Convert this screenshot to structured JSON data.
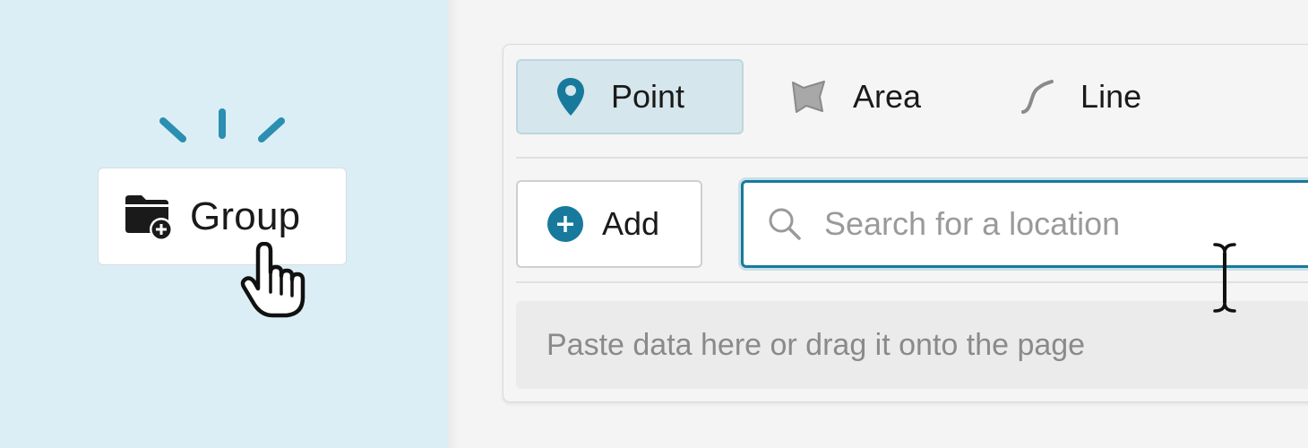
{
  "group_button": {
    "label": "Group",
    "icon": "folder-add-icon"
  },
  "tabs": [
    {
      "label": "Point",
      "icon": "map-pin-icon",
      "active": true
    },
    {
      "label": "Area",
      "icon": "area-icon",
      "active": false
    },
    {
      "label": "Line",
      "icon": "line-icon",
      "active": false
    }
  ],
  "add_button": {
    "label": "Add",
    "icon": "plus-circle-icon"
  },
  "search": {
    "placeholder": "Search for a location",
    "value": "",
    "icon": "search-icon"
  },
  "paste_area": {
    "hint": "Paste data here or drag it onto the page"
  },
  "colors": {
    "accent": "#177a9c",
    "left_background": "#dceef5",
    "active_tab_background": "#d5e6ec"
  }
}
